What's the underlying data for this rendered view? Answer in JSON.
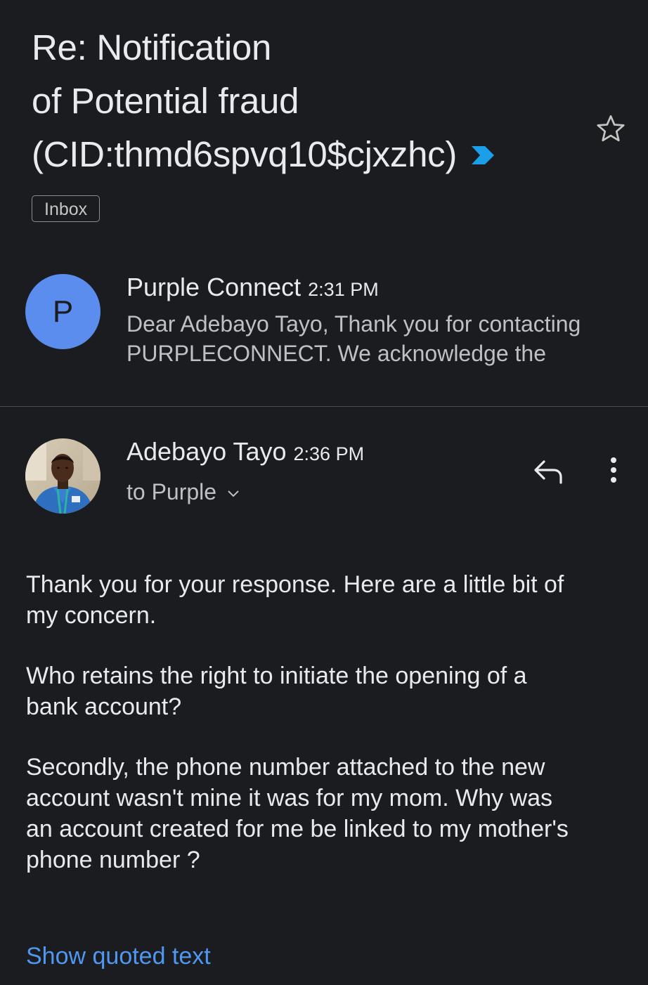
{
  "thread": {
    "subject_lines": [
      "Re: Notification",
      "of Potential fraud",
      "(CID:thmd6spvq10$cjxzhc)"
    ],
    "label": "Inbox",
    "importance_icon": "importance-marker-icon",
    "star_icon": "star-outline-icon"
  },
  "messages": [
    {
      "avatar_letter": "P",
      "avatar_color": "#5b8def",
      "sender": "Purple Connect",
      "time": "2:31 PM",
      "snippet_lines": [
        "Dear Adebayo Tayo, Thank you for contacting",
        "PURPLECONNECT. We acknowledge the"
      ]
    },
    {
      "avatar_icon": "profile-photo",
      "sender": "Adebayo Tayo",
      "time": "2:36 PM",
      "recipient": "to Purple",
      "reply_icon": "reply-icon",
      "more_icon": "more-vert-icon",
      "body": [
        [
          "Thank you for your response. Here are a little bit of",
          "my concern."
        ],
        [
          "Who retains the right to initiate the opening of a",
          "bank account?"
        ],
        [
          "Secondly, the phone number attached to the new",
          "account wasn't mine it was for my mom. Why was",
          "an account created for me be linked to my mother's",
          "phone number ?"
        ]
      ],
      "show_quoted": "Show quoted text"
    }
  ],
  "colors": {
    "background": "#1b1c1f",
    "link": "#4f97f0",
    "importance": "#1a9fe8"
  }
}
